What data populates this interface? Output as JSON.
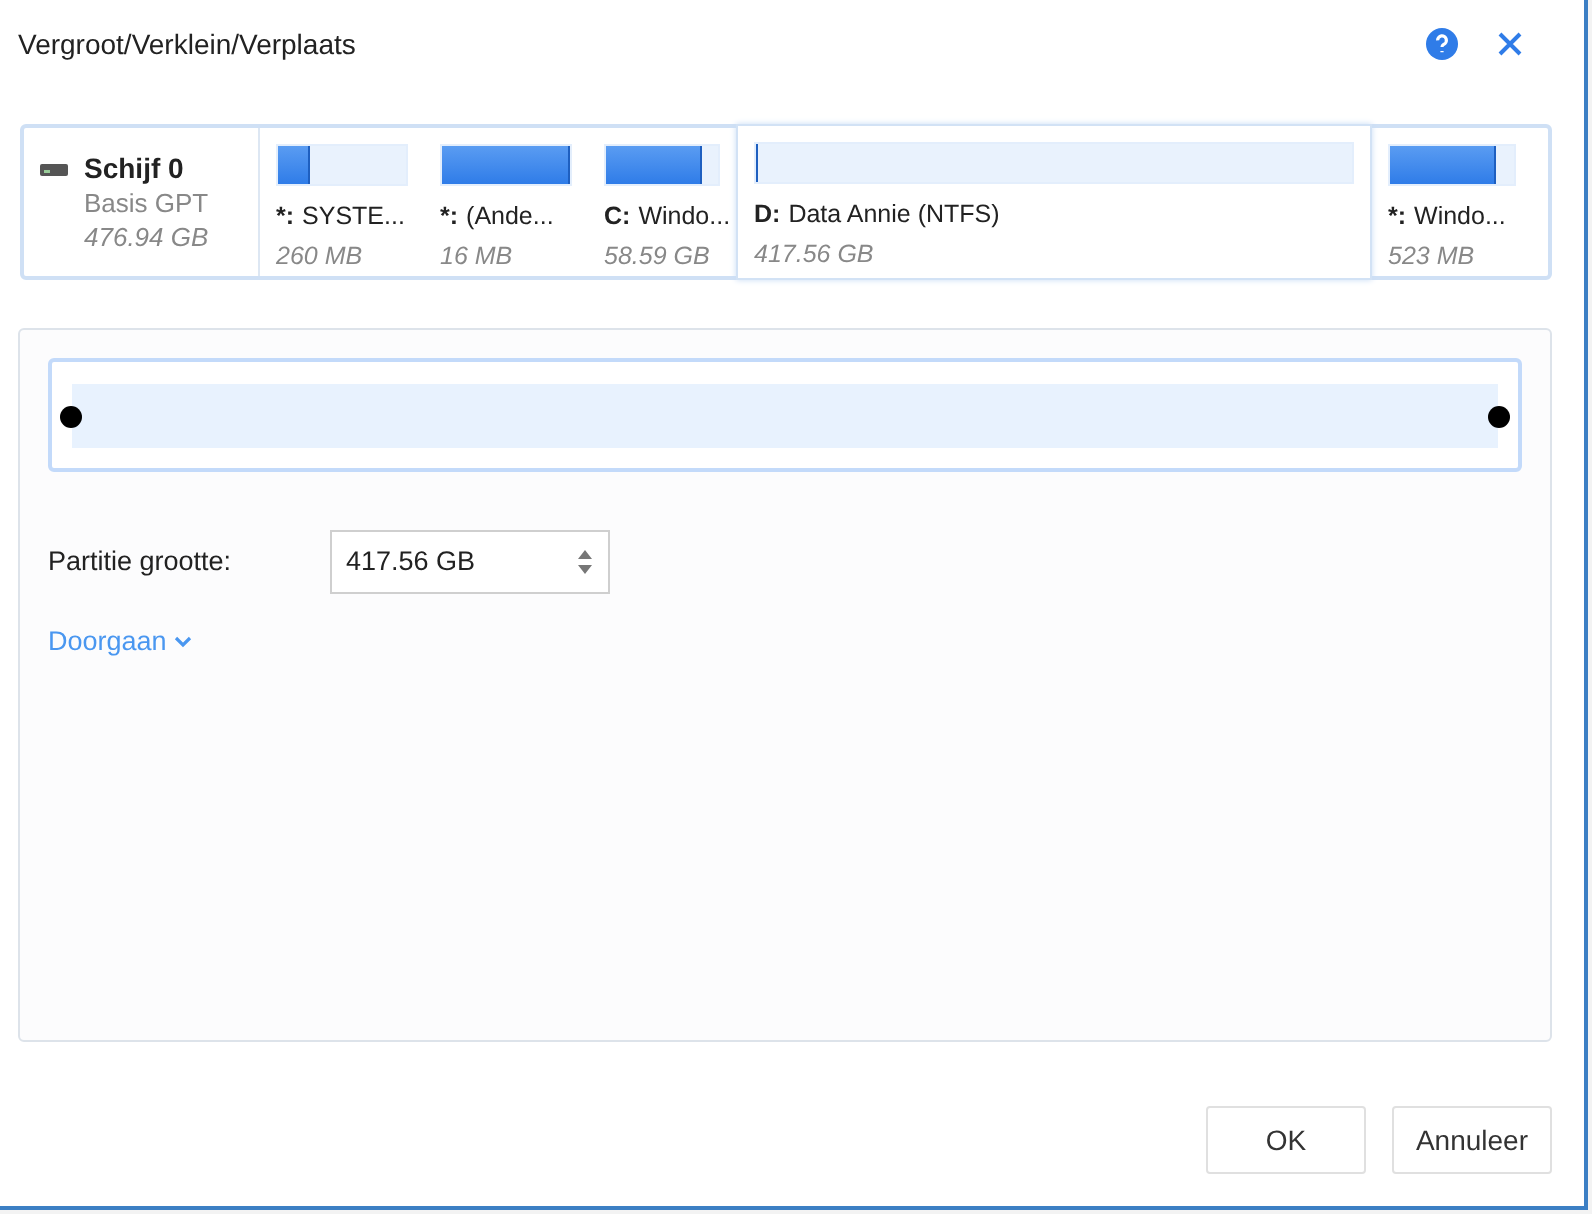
{
  "window": {
    "title": "Vergroot/Verklein/Verplaats"
  },
  "disk": {
    "name": "Schijf 0",
    "type": "Basis GPT",
    "size": "476.94 GB"
  },
  "partitions": [
    {
      "letter": "*:",
      "name": "SYSTE...",
      "size": "260 MB",
      "level": 0.25,
      "selected": false
    },
    {
      "letter": "*:",
      "name": "(Ande...",
      "size": "16 MB",
      "level": 1.0,
      "selected": false
    },
    {
      "letter": "C:",
      "name": "Windo...",
      "size": "58.59 GB",
      "level": 0.85,
      "selected": false
    },
    {
      "letter": "D:",
      "name": "Data Annie (NTFS)",
      "size": "417.56 GB",
      "level": 0.005,
      "selected": true
    },
    {
      "letter": "*:",
      "name": "Windo...",
      "size": "523 MB",
      "level": 0.85,
      "selected": false
    }
  ],
  "resize": {
    "level": 1.0
  },
  "size_field": {
    "label": "Partitie grootte:",
    "value": "417.56 GB"
  },
  "advanced_link": "Doorgaan",
  "buttons": [
    "OK",
    "Annuleer"
  ]
}
